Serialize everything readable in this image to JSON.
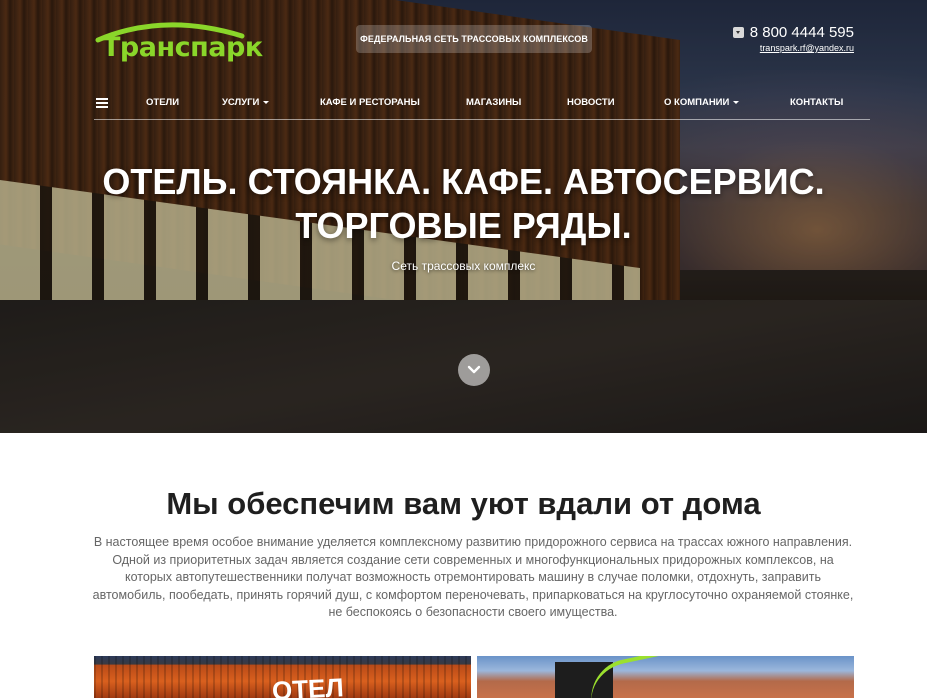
{
  "header": {
    "logo_text": "Транспарк",
    "tagline": "ФЕДЕРАЛЬНАЯ СЕТЬ ТРАССОВЫХ КОМПЛЕКСОВ",
    "phone": "8 800 4444 595",
    "email": "transpark.rf@yandex.ru"
  },
  "nav": {
    "items": [
      {
        "label": "ОТЕЛИ",
        "has_dropdown": false
      },
      {
        "label": "УСЛУГИ",
        "has_dropdown": true
      },
      {
        "label": "КАФЕ И РЕСТОРАНЫ",
        "has_dropdown": false
      },
      {
        "label": "МАГАЗИНЫ",
        "has_dropdown": false
      },
      {
        "label": "НОВОСТИ",
        "has_dropdown": false
      },
      {
        "label": "О КОМПАНИИ",
        "has_dropdown": true
      },
      {
        "label": "КОНТАКТЫ",
        "has_dropdown": false
      }
    ]
  },
  "hero": {
    "title_line1": "ОТЕЛЬ. СТОЯНКА. КАФЕ. АВТОСЕРВИС.",
    "title_line2": "ТОРГОВЫЕ РЯДЫ.",
    "subtitle": "Сеть трассовых комплекс",
    "scroll_icon": "chevron-down-icon"
  },
  "intro": {
    "title": "Мы обеспечим вам уют вдали от дома",
    "text": "В настоящее время особое внимание уделяется комплексному развитию придорожного сервиса на трассах южного направления. Одной из приоритетных задач является создание сети современных и многофункциональных придорожных комплексов, на которых автопутешественники получат возможность отремонтировать машину в случае поломки, отдохнуть, заправить автомобиль, пообедать, принять горячий душ, с комфортом переночевать, припарковаться на круглосуточно охраняемой стоянке, не беспокоясь о безопасности своего имущества."
  },
  "cards": {
    "left_label": "ОТЕЛ"
  },
  "colors": {
    "brand_green": "#8ad62a",
    "heading": "#1f1f1f",
    "body_text": "#666666"
  }
}
